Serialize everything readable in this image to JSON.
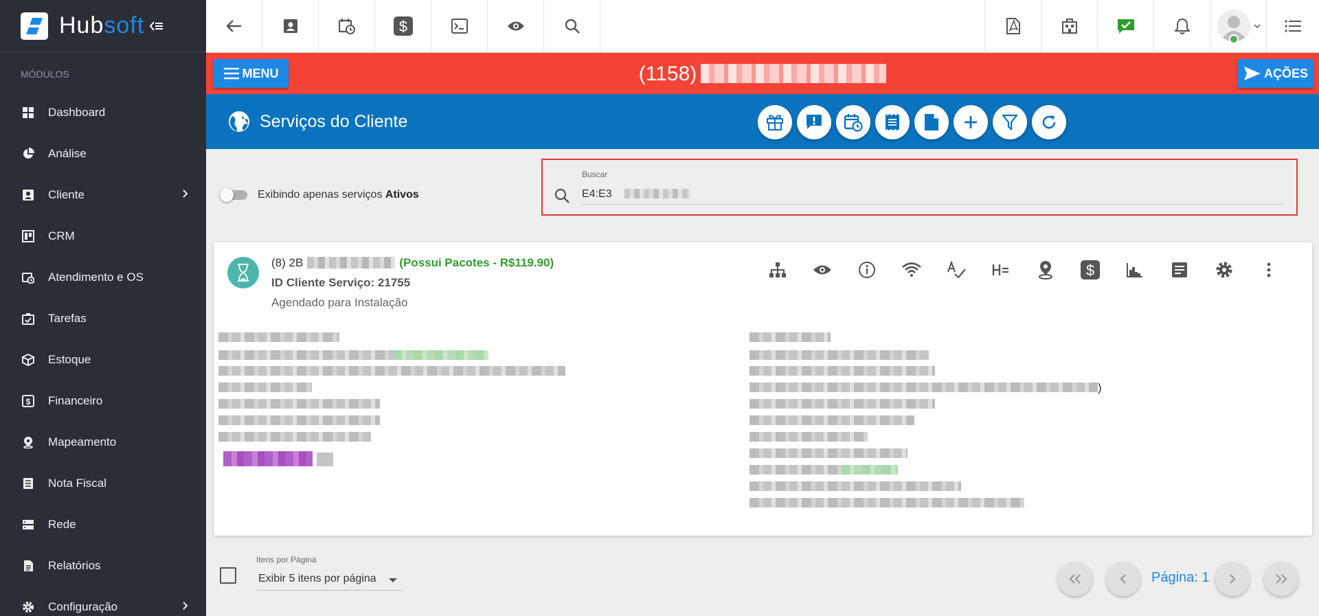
{
  "brand": {
    "name_part1": "Hub",
    "name_part2": "soft"
  },
  "sidebar": {
    "section_label": "MÓDULOS",
    "items": [
      {
        "label": "Dashboard",
        "icon": "dashboard-icon",
        "has_children": false
      },
      {
        "label": "Análise",
        "icon": "pie-chart-icon",
        "has_children": false
      },
      {
        "label": "Cliente",
        "icon": "contact-card-icon",
        "has_children": true
      },
      {
        "label": "CRM",
        "icon": "kanban-icon",
        "has_children": false
      },
      {
        "label": "Atendimento e OS",
        "icon": "calendar-clock-icon",
        "has_children": false
      },
      {
        "label": "Tarefas",
        "icon": "task-icon",
        "has_children": false
      },
      {
        "label": "Estoque",
        "icon": "box-icon",
        "has_children": false
      },
      {
        "label": "Financeiro",
        "icon": "money-icon",
        "has_children": false
      },
      {
        "label": "Mapeamento",
        "icon": "map-pin-icon",
        "has_children": false
      },
      {
        "label": "Nota Fiscal",
        "icon": "invoice-icon",
        "has_children": false
      },
      {
        "label": "Rede",
        "icon": "server-icon",
        "has_children": false
      },
      {
        "label": "Relatórios",
        "icon": "report-icon",
        "has_children": false
      },
      {
        "label": "Configuração",
        "icon": "gear-icon",
        "has_children": true
      }
    ]
  },
  "header": {
    "menu_label": "MENU",
    "actions_label": "AÇÕES",
    "client_code": "(1158)"
  },
  "section": {
    "title": "Serviços do Cliente"
  },
  "filter": {
    "toggle_text": "Exibindo apenas serviços ",
    "toggle_bold": "Ativos",
    "toggle_on": false
  },
  "search": {
    "label": "Buscar",
    "value": "E4:E3"
  },
  "service": {
    "code_prefix": "(8) 2B",
    "pacotes": "(Possui Pacotes - R$119.90)",
    "id_line": "ID Cliente Serviço: 21755",
    "status": "Agendado para Instalação",
    "right_trailing": ")"
  },
  "footer": {
    "items_per_page_label": "Itens por Página",
    "items_per_page_value": "Exibir 5 itens por página",
    "page_label": "Página: 1"
  },
  "colors": {
    "sidebar_bg": "#2b2e37",
    "client_bar": "#f44336",
    "section_bar": "#0a73bf",
    "accent": "#1e88e5",
    "success": "#2e9d2e",
    "status_avatar": "#4db6ac"
  }
}
